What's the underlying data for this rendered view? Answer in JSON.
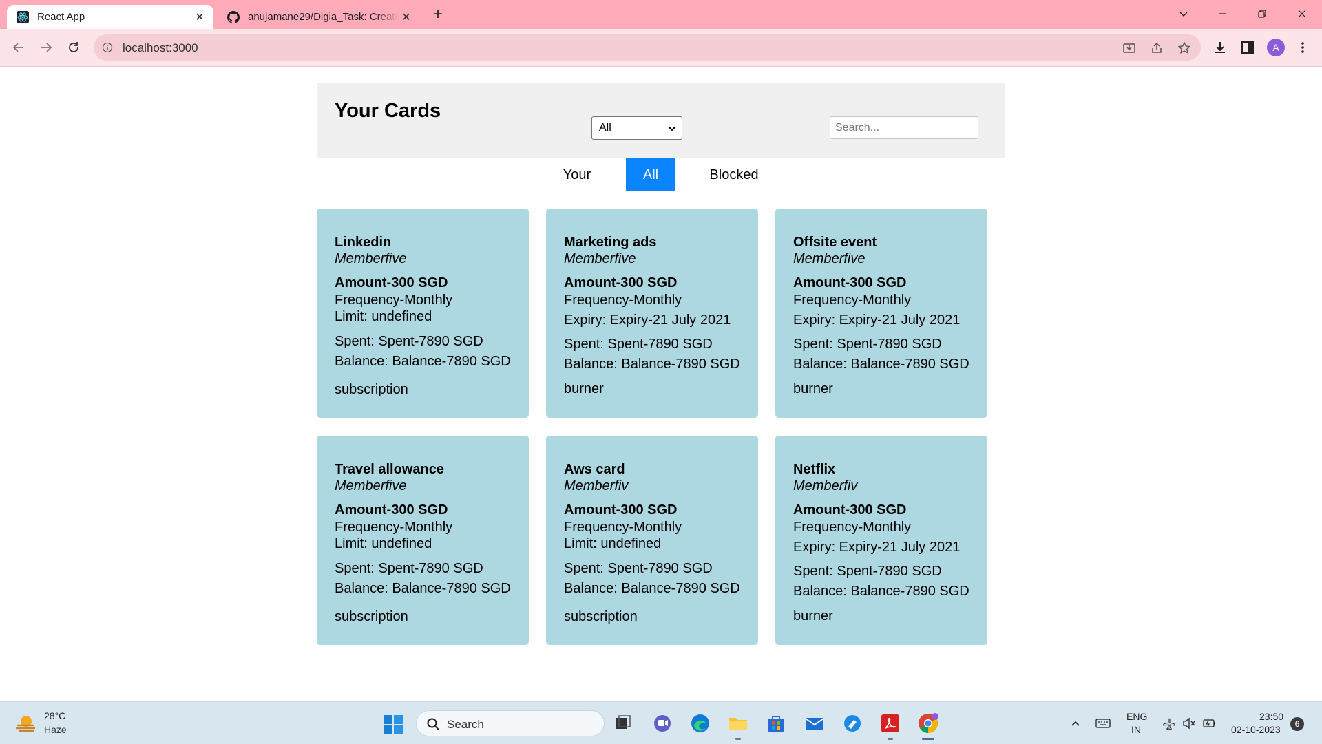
{
  "browser": {
    "tabs": [
      {
        "title": "React App",
        "icon": "react-icon",
        "active": true
      },
      {
        "title": "anujamane29/Digia_Task: Create",
        "icon": "github-icon",
        "active": false
      }
    ],
    "url": "localhost:3000",
    "profile_initial": "A",
    "tab_close_glyph": "✕",
    "new_tab_glyph": "+",
    "colors": {
      "tabbar": "#ffabb9",
      "toolbar": "#fde4e8",
      "omnibox": "#f5cdd4"
    }
  },
  "page": {
    "title": "Your Cards",
    "filter": {
      "selected": "All"
    },
    "search": {
      "placeholder": "Search..."
    },
    "view_tabs": [
      {
        "label": "Your",
        "selected": false
      },
      {
        "label": "All",
        "selected": true
      },
      {
        "label": "Blocked",
        "selected": false
      }
    ],
    "colors": {
      "card_bg": "#add8e2",
      "tab_active": "#0b84ff",
      "header_bg": "#f0f0f0"
    },
    "cards": [
      {
        "name": "Linkedin",
        "member": "Memberfive",
        "amount": "Amount-300 SGD",
        "frequency": "Frequency-Monthly",
        "detail": "Limit: undefined",
        "spent": "Spent: Spent-7890 SGD",
        "balance": "Balance: Balance-7890 SGD",
        "type": "subscription"
      },
      {
        "name": "Marketing ads",
        "member": "Memberfive",
        "amount": "Amount-300 SGD",
        "frequency": "Frequency-Monthly",
        "detail": "Expiry: Expiry-21 July 2021",
        "spent": "Spent: Spent-7890 SGD",
        "balance": "Balance: Balance-7890 SGD",
        "type": "burner"
      },
      {
        "name": "Offsite event",
        "member": "Memberfive",
        "amount": "Amount-300 SGD",
        "frequency": "Frequency-Monthly",
        "detail": "Expiry: Expiry-21 July 2021",
        "spent": "Spent: Spent-7890 SGD",
        "balance": "Balance: Balance-7890 SGD",
        "type": "burner"
      },
      {
        "name": "Travel allowance",
        "member": "Memberfive",
        "amount": "Amount-300 SGD",
        "frequency": "Frequency-Monthly",
        "detail": "Limit: undefined",
        "spent": "Spent: Spent-7890 SGD",
        "balance": "Balance: Balance-7890 SGD",
        "type": "subscription"
      },
      {
        "name": "Aws card",
        "member": "Memberfiv",
        "amount": "Amount-300 SGD",
        "frequency": "Frequency-Monthly",
        "detail": "Limit: undefined",
        "spent": "Spent: Spent-7890 SGD",
        "balance": "Balance: Balance-7890 SGD",
        "type": "subscription"
      },
      {
        "name": "Netflix",
        "member": "Memberfiv",
        "amount": "Amount-300 SGD",
        "frequency": "Frequency-Monthly",
        "detail": "Expiry: Expiry-21 July 2021",
        "spent": "Spent: Spent-7890 SGD",
        "balance": "Balance: Balance-7890 SGD",
        "type": "burner"
      }
    ]
  },
  "taskbar": {
    "weather": {
      "temp": "28°C",
      "condition": "Haze"
    },
    "search_label": "Search",
    "apps": [
      "task-view-icon",
      "teams-chat-icon",
      "edge-icon",
      "file-explorer-icon",
      "microsoft-store-icon",
      "mail-icon",
      "app-icon",
      "acrobat-icon",
      "chrome-icon"
    ],
    "tray": {
      "lang_line1": "ENG",
      "lang_line2": "IN",
      "time": "23:50",
      "date": "02-10-2023",
      "notifications": "6"
    }
  }
}
